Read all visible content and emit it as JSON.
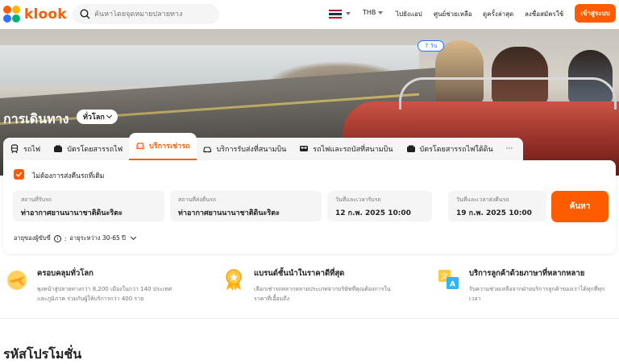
{
  "header": {
    "brand": "klook",
    "search_placeholder": "ค้นหาโดยจุดหมายปลายทาง",
    "currency": "THB",
    "nav": [
      "ไปยังแอป",
      "ศูนย์ช่วยเหลือ",
      "ดูครั้งล่าสุด",
      "ลงชื่อสมัครใช้"
    ],
    "login": "เข้าสู่ระบบ"
  },
  "hero": {
    "title": "การเดินทาง",
    "region": "ทั่วโลก"
  },
  "tabs": [
    {
      "label": "รถไฟ",
      "icon": "train-icon"
    },
    {
      "label": "บัตรโดยสารรถไฟ",
      "icon": "rail-pass-icon"
    },
    {
      "label": "บริการเช่ารถ",
      "icon": "car-icon",
      "active": true
    },
    {
      "label": "บริการรับส่งที่สนามบิน",
      "icon": "airport-transfer-icon"
    },
    {
      "label": "รถไฟและรถบัสที่สนามบิน",
      "icon": "airport-train-icon"
    },
    {
      "label": "บัตรโดยสารรถไฟใต้ดิน",
      "icon": "metro-card-icon"
    },
    {
      "label": "···",
      "icon": "more-icon"
    }
  ],
  "booking": {
    "return_checkbox": "ไม่ต้องการส่งคืนรถที่เดิม",
    "pickup_label": "สถานที่รับรถ",
    "pickup_value": "ท่าอากาศยานนานาชาติดินะริตะ",
    "dropoff_label": "สถานที่ส่งคืนรถ",
    "dropoff_value": "ท่าอากาศยานนานาชาติดินะริตะ",
    "pickup_time_label": "วันที่และเวลารับรถ",
    "pickup_time_value": "12 ก.พ. 2025 10:00",
    "days": "7 วัน",
    "return_time_label": "วันที่และเวลาส่งคืนรถ",
    "return_time_value": "19 ก.พ. 2025 10:00",
    "search_button": "ค้นหา",
    "driver_age_label": "อายุของผู้ขับขี่",
    "driver_age_value": "อายุระหว่าง 30-65 ปี"
  },
  "features": [
    {
      "title": "ครอบคลุมทั่วโลก",
      "desc1": "พุงหน้าสู่ปลายทางกว่า 8,200 เมืองในกว่า 140 ประเทศ",
      "desc2": "และภูมิภาค ร่วมกับผู้ให้บริการกว่า 400 ราย"
    },
    {
      "title": "แบรนด์ชั้นนำในราคาดีที่สุด",
      "desc1": "เลือกเช่ารถหลากหลายประเภทจากบริษัทที่คุณต้องการใน",
      "desc2": "ราคาที่เอื้อมถึง"
    },
    {
      "title": "บริการลูกค้าด้วยภาษาที่หลากหลาย",
      "desc1": "รับความช่วยเหลือจากฝ่ายบริการลูกค้าของเราได้ทุกที่ทุก",
      "desc2": "เวลา"
    }
  ],
  "promo": {
    "title": "รหัสโปรโมชั่น"
  },
  "colors": {
    "accent": "#ff5b00",
    "blue": "#2874ff"
  }
}
